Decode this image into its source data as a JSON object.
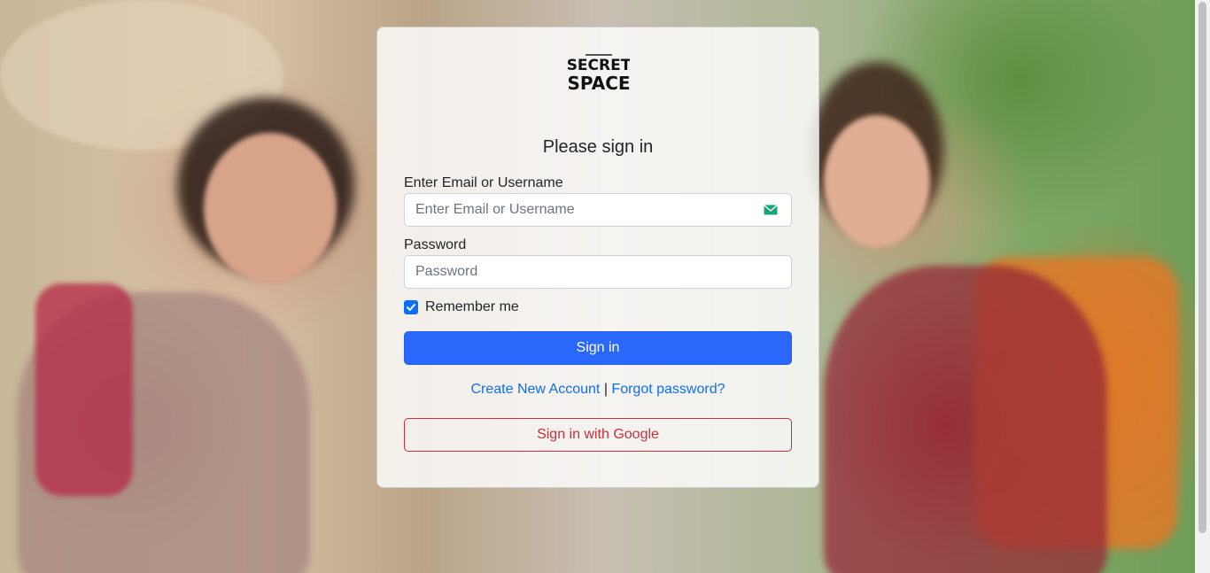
{
  "brand": {
    "logo_top": "SECRET",
    "logo_bottom": "SPACE"
  },
  "form": {
    "title": "Please sign in",
    "email_label": "Enter Email or Username",
    "email_placeholder": "Enter Email or Username",
    "email_value": "",
    "email_icon": "envelope-icon",
    "password_label": "Password",
    "password_placeholder": "Password",
    "password_value": "",
    "remember_label": "Remember me",
    "remember_checked": true,
    "sign_in_label": "Sign in",
    "create_account_label": "Create New Account",
    "link_separator": "|",
    "forgot_password_label": "Forgot password?",
    "google_label": "Sign in with Google"
  },
  "colors": {
    "primary": "#2a68fb",
    "link": "#0d6efd",
    "google": "#c9303c",
    "mail_icon": "#1aa37a"
  }
}
